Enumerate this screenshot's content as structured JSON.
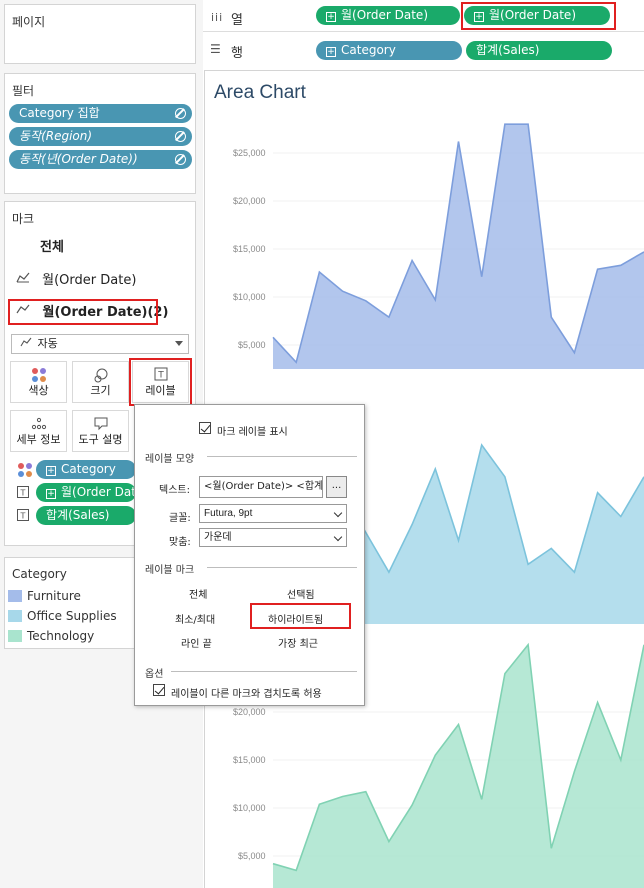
{
  "pages_panel": {
    "title": "페이지"
  },
  "filters_panel": {
    "title": "필터",
    "items": [
      {
        "label": "Category 집합",
        "italic": false
      },
      {
        "label": "동작(Region)",
        "italic": true
      },
      {
        "label": "동작(년(Order Date))",
        "italic": true
      }
    ]
  },
  "shelves": {
    "columns": {
      "label": "열",
      "pills": [
        "월(Order Date)",
        "월(Order Date)"
      ]
    },
    "rows": {
      "label": "행",
      "pills": [
        "Category",
        "합계(Sales)"
      ]
    }
  },
  "marks_panel": {
    "title": "마크",
    "all": "전체",
    "tab1": "월(Order Date)",
    "tab2": "월(Order Date)(2)",
    "type_dropdown": "자동",
    "buttons": {
      "color": "색상",
      "size": "크기",
      "label": "레이블",
      "detail": "세부 정보",
      "tooltip": "도구 설명"
    },
    "fields": [
      {
        "label": "Category",
        "kind": "color"
      },
      {
        "label": "월(Order Date)",
        "kind": "label"
      },
      {
        "label": "합계(Sales)",
        "kind": "label"
      }
    ]
  },
  "legend": {
    "title": "Category",
    "items": [
      {
        "label": "Furniture",
        "color": "#a4bcea"
      },
      {
        "label": "Office Supplies",
        "color": "#a7d8ea"
      },
      {
        "label": "Technology",
        "color": "#a9e4ce"
      }
    ]
  },
  "label_popup": {
    "show_labels": "마크 레이블 표시",
    "appearance_title": "레이블 모양",
    "text_label": "텍스트:",
    "text_value": "<월(Order Date)> <합계(Sales)>",
    "ellipsis": "...",
    "font_label": "글꼴:",
    "font_value": "Futura, 9pt",
    "align_label": "맞춤:",
    "align_value": "가운데",
    "marks_title": "레이블 마크",
    "options_marks": [
      "전체",
      "선택됨",
      "최소/최대",
      "하이라이트됨",
      "라인 끝",
      "가장 최근"
    ],
    "options_title": "옵션",
    "overlap": "레이블이 다른 마크와 겹치도록 허용"
  },
  "chart": {
    "title": "Area Chart",
    "colors": {
      "furniture": "#a4bcea",
      "furniture_line": "#7d9edc",
      "office": "#a7d8ea",
      "office_line": "#7cc3dc",
      "tech": "#a9e4ce",
      "tech_line": "#80d2b3"
    }
  },
  "chart_data": {
    "type": "area",
    "title": "Area Chart",
    "series": [
      {
        "name": "Furniture",
        "ylim": [
          3000,
          28000
        ],
        "values": [
          5800,
          3200,
          12600,
          10600,
          9600,
          7900,
          13800,
          9700,
          26200,
          12100,
          28000,
          28000,
          7900,
          4200,
          12900,
          13300,
          14700
        ]
      },
      {
        "name": "Office Supplies",
        "values": [
          0.45,
          0.6,
          0.5,
          0.7,
          0.45,
          0.2,
          0.5,
          0.85,
          0.4,
          1.0,
          0.8,
          0.25,
          0.35,
          0.2,
          0.7,
          0.55,
          0.8
        ]
      },
      {
        "name": "Technology",
        "ylim": [
          3500,
          27000
        ],
        "values": [
          4200,
          3500,
          10400,
          11200,
          11700,
          6500,
          10300,
          15500,
          18700,
          10900,
          24000,
          27000,
          5800,
          13800,
          21000,
          15000,
          27000
        ]
      }
    ],
    "yticks_top": [
      "$25,000",
      "$20,000",
      "$15,000",
      "$10,000",
      "$5,000"
    ],
    "yticks_bottom": [
      "$20,000",
      "$15,000",
      "$10,000",
      "$5,000"
    ]
  }
}
